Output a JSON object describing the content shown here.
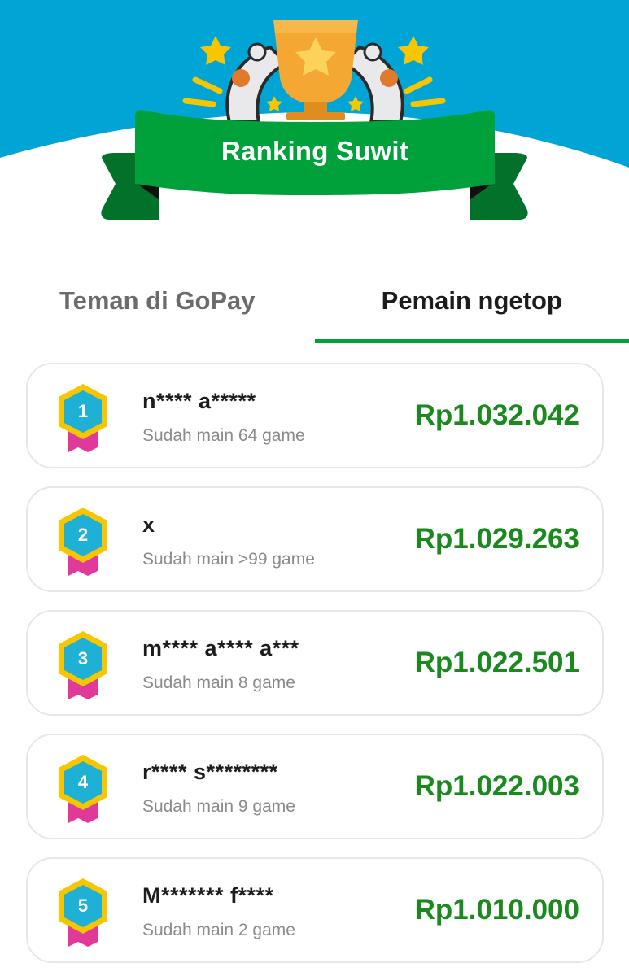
{
  "header": {
    "title": "Ranking Suwit",
    "trophy_icon": "trophy-icon",
    "colors": {
      "sky": "#00a5d6",
      "banner": "#00a13a",
      "banner_dark": "#02722b",
      "trophy": "#f5a733"
    }
  },
  "tabs": [
    {
      "label": "Teman di GoPay",
      "active": false
    },
    {
      "label": "Pemain ngetop",
      "active": true
    }
  ],
  "leaderboard": [
    {
      "rank": "1",
      "name": "n**** a*****",
      "games": "Sudah main 64 game",
      "amount": "Rp1.032.042"
    },
    {
      "rank": "2",
      "name": "x",
      "games": "Sudah main >99 game",
      "amount": "Rp1.029.263"
    },
    {
      "rank": "3",
      "name": "m**** a**** a***",
      "games": "Sudah main 8 game",
      "amount": "Rp1.022.501"
    },
    {
      "rank": "4",
      "name": "r**** s********",
      "games": "Sudah main 9 game",
      "amount": "Rp1.022.003"
    },
    {
      "rank": "5",
      "name": "M******* f****",
      "games": "Sudah main 2 game",
      "amount": "Rp1.010.000"
    }
  ],
  "colors": {
    "accent_green": "#00a13a",
    "amount_green": "#1a8a1f",
    "badge_blue": "#1fb0d6",
    "badge_gold": "#f7c600",
    "ribbon_pink": "#e0399a"
  }
}
